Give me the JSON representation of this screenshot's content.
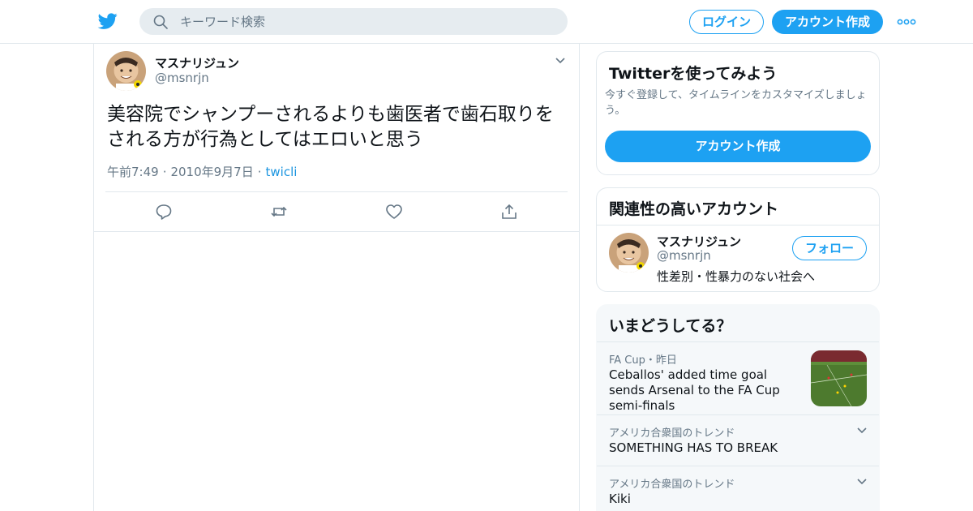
{
  "header": {
    "search_placeholder": "キーワード検索",
    "login_label": "ログイン",
    "signup_label": "アカウント作成"
  },
  "tweet": {
    "display_name": "マスナリジュン",
    "handle": "@msnrjn",
    "text": "美容院でシャンプーされるよりも歯医者で歯石取りをされる方が行為としてはエロいと思う",
    "time": "午前7:49",
    "date": "2010年9月7日",
    "source": "twicli"
  },
  "signup_card": {
    "title": "Twitterを使ってみよう",
    "subtitle": "今すぐ登録して、タイムラインをカスタマイズしましょう。",
    "button_label": "アカウント作成"
  },
  "related_card": {
    "title": "関連性の高いアカウント",
    "account": {
      "display_name": "マスナリジュン",
      "handle": "@msnrjn",
      "bio": "性差別・性暴力のない社会へ",
      "follow_label": "フォロー"
    }
  },
  "trends_card": {
    "title": "いまどうしてる？",
    "items": [
      {
        "context": "FA Cup・昨日",
        "name": "Ceballos' added time goal sends Arsenal to the FA Cup semi-finals"
      },
      {
        "context": "アメリカ合衆国のトレンド",
        "name": "SOMETHING HAS TO BREAK"
      },
      {
        "context": "アメリカ合衆国のトレンド",
        "name": "Kiki"
      }
    ]
  },
  "colors": {
    "accent": "#1da1f2",
    "link": "#1b95e0",
    "secondary_text": "#657786",
    "border": "#e1e8ed"
  }
}
